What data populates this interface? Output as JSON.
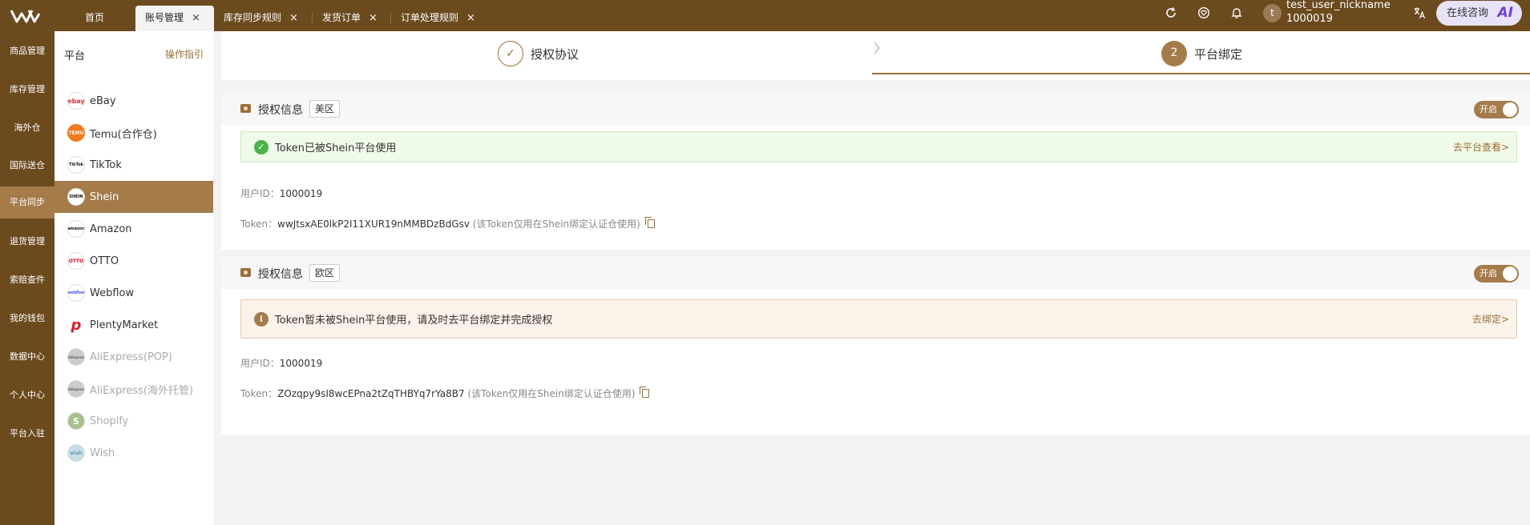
{
  "header": {
    "tabs": [
      {
        "label": "首页"
      },
      {
        "label": "账号管理"
      },
      {
        "label": "库存同步规则"
      },
      {
        "label": "发货订单"
      },
      {
        "label": "订单处理规则"
      }
    ],
    "close_glyph": "×",
    "avatar_letter": "t",
    "user_name": "test_user_nickname",
    "user_id": "1000019",
    "consult_label": "在线咨询",
    "consult_ai": "AI",
    "icons": [
      "refresh-icon",
      "heart-icon",
      "bell-icon",
      "translate-icon"
    ]
  },
  "nav": {
    "items": [
      "商品管理",
      "库存管理",
      "海外仓",
      "国际送仓",
      "平台同步",
      "退货管理",
      "索赔查件",
      "我的钱包",
      "数据中心",
      "个人中心",
      "平台入驻"
    ],
    "active": "平台同步"
  },
  "platforms": {
    "title": "平台",
    "guide": "操作指引",
    "items": [
      {
        "label": "eBay",
        "logo": "ebay"
      },
      {
        "label": "Temu(合作仓)",
        "logo": "TEMU"
      },
      {
        "label": "TikTok",
        "logo": "TikTok"
      },
      {
        "label": "Shein",
        "logo": "SHEIN"
      },
      {
        "label": "Amazon",
        "logo": "amazon"
      },
      {
        "label": "OTTO",
        "logo": "OTTO"
      },
      {
        "label": "Webflow",
        "logo": "webflow"
      },
      {
        "label": "PlentyMarket",
        "logo": "p"
      },
      {
        "label": "AliExpress(POP)",
        "logo": "AliExpress"
      },
      {
        "label": "AliExpress(海外托管)",
        "logo": "AliExpress"
      },
      {
        "label": "Shopify",
        "logo": "S"
      },
      {
        "label": "Wish",
        "logo": "wish"
      }
    ],
    "active": "Shein"
  },
  "steps": {
    "step1_glyph": "✓",
    "step1_label": "授权协议",
    "step2_number": "2",
    "step2_label": "平台绑定"
  },
  "sections": [
    {
      "title": "授权信息",
      "region": "美区",
      "toggle_label": "开启",
      "alert_type": "success",
      "alert_icon": "✓",
      "alert_text": "Token已被Shein平台使用",
      "alert_link": "去平台查看>",
      "user_id_label": "用户ID：",
      "user_id": "1000019",
      "token_label": "Token：",
      "token": "wwJtsxAE0lkP2I11XUR19nMMBDzBdGsv",
      "token_note": "(该Token仅用在Shein绑定认证仓使用)"
    },
    {
      "title": "授权信息",
      "region": "欧区",
      "toggle_label": "开启",
      "alert_type": "warning",
      "alert_icon": "i",
      "alert_text": "Token暂未被Shein平台使用，请及时去平台绑定并完成授权",
      "alert_link": "去绑定>",
      "user_id_label": "用户ID：",
      "user_id": "1000019",
      "token_label": "Token：",
      "token": "ZOzqpy9sI8wcEPna2tZqTHBYq7rYa8B7",
      "token_note": "(该Token仅用在Shein绑定认证仓使用)"
    }
  ],
  "colors": {
    "brand": "#6b4a1e",
    "accent": "#a57b4a",
    "link": "#9b6e35",
    "success": "#4bb34a",
    "ai": "#6b3fd9"
  }
}
